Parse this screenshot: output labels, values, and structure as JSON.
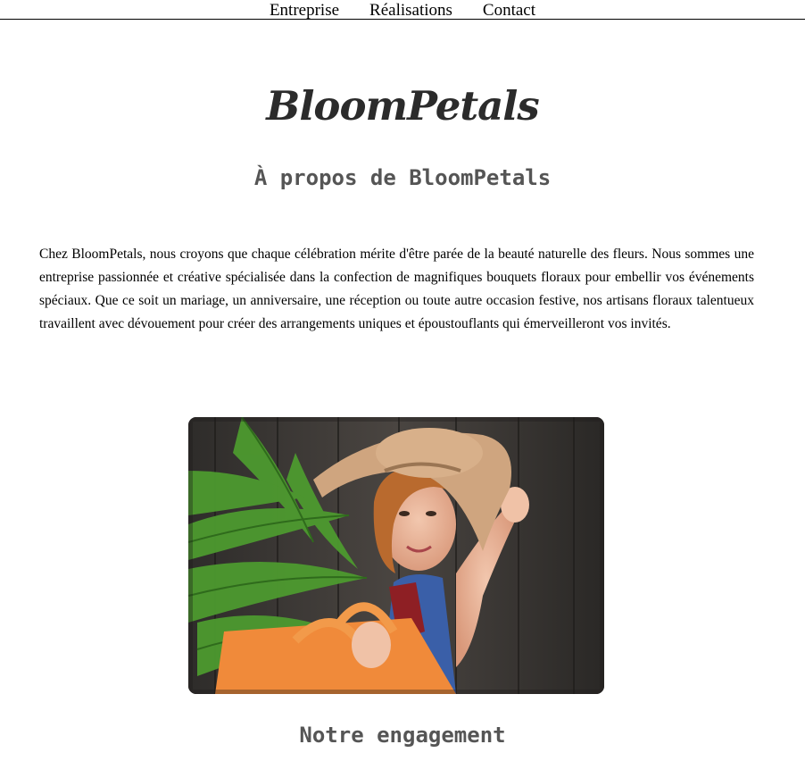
{
  "nav": {
    "items": [
      {
        "label": "Entreprise"
      },
      {
        "label": "Réalisations"
      },
      {
        "label": "Contact"
      }
    ]
  },
  "brand": {
    "name": "BloomPetals"
  },
  "about": {
    "title": "À propos de BloomPetals",
    "text": "Chez BloomPetals, nous croyons que chaque célébration mérite d'être parée de la beauté naturelle des fleurs. Nous sommes une entreprise passionnée et créative spécialisée dans la confection de magnifiques bouquets floraux pour embellir vos événements spéciaux. Que ce soit un mariage, un anniversaire, une réception ou toute autre occasion festive, nos artisans floraux talentueux travaillent avec dévouement pour créer des arrangements uniques et époustouflants qui émerveilleront vos invités."
  },
  "photo": {
    "subject": "woman-with-hat-fern-orange-bag"
  },
  "engagement": {
    "title": "Notre engagement"
  },
  "colors": {
    "heading": "#555555",
    "brand": "#2b2b2b",
    "text": "#000000"
  }
}
